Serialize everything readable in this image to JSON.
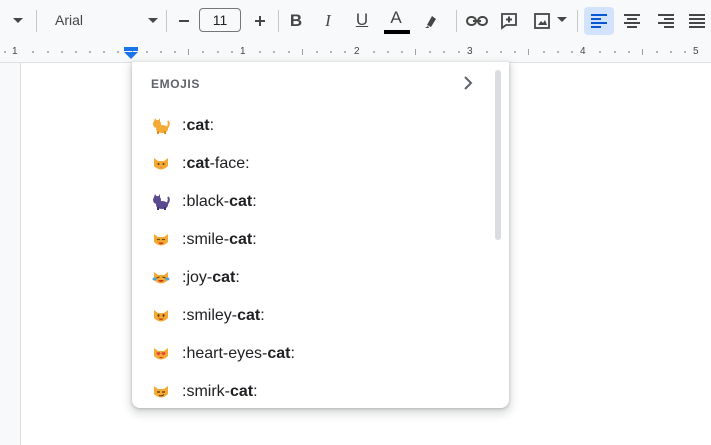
{
  "toolbar": {
    "font_name": "Arial",
    "font_size": "11",
    "minus_label": "−",
    "plus_label": "+",
    "bold_label": "B",
    "italic_label": "I",
    "underline_label": "U",
    "text_color_label": "A"
  },
  "ruler": {
    "numbers": [
      "1",
      "1",
      "2",
      "3",
      "4",
      "5"
    ]
  },
  "emoji_popup": {
    "title": "EMOJIS",
    "items": [
      {
        "prefix": ":",
        "bold": "cat",
        "suffix": ":",
        "icon": "cat-emoji"
      },
      {
        "prefix": ":",
        "bold": "cat",
        "suffix": "-face:",
        "icon": "cat-face-emoji"
      },
      {
        "prefix": ":black-",
        "bold": "cat",
        "suffix": ":",
        "icon": "black-cat-emoji"
      },
      {
        "prefix": ":smile-",
        "bold": "cat",
        "suffix": ":",
        "icon": "smile-cat-emoji"
      },
      {
        "prefix": ":joy-",
        "bold": "cat",
        "suffix": ":",
        "icon": "joy-cat-emoji"
      },
      {
        "prefix": ":smiley-",
        "bold": "cat",
        "suffix": ":",
        "icon": "smiley-cat-emoji"
      },
      {
        "prefix": ":heart-eyes-",
        "bold": "cat",
        "suffix": ":",
        "icon": "heart-eyes-cat-emoji"
      },
      {
        "prefix": ":smirk-",
        "bold": "cat",
        "suffix": ":",
        "icon": "smirk-cat-emoji"
      }
    ]
  },
  "colors": {
    "accent_blue": "#0b57d0",
    "text_color_bar": "#000000",
    "cat_orange": "#f4a935",
    "black_cat": "#5a4a8f"
  }
}
